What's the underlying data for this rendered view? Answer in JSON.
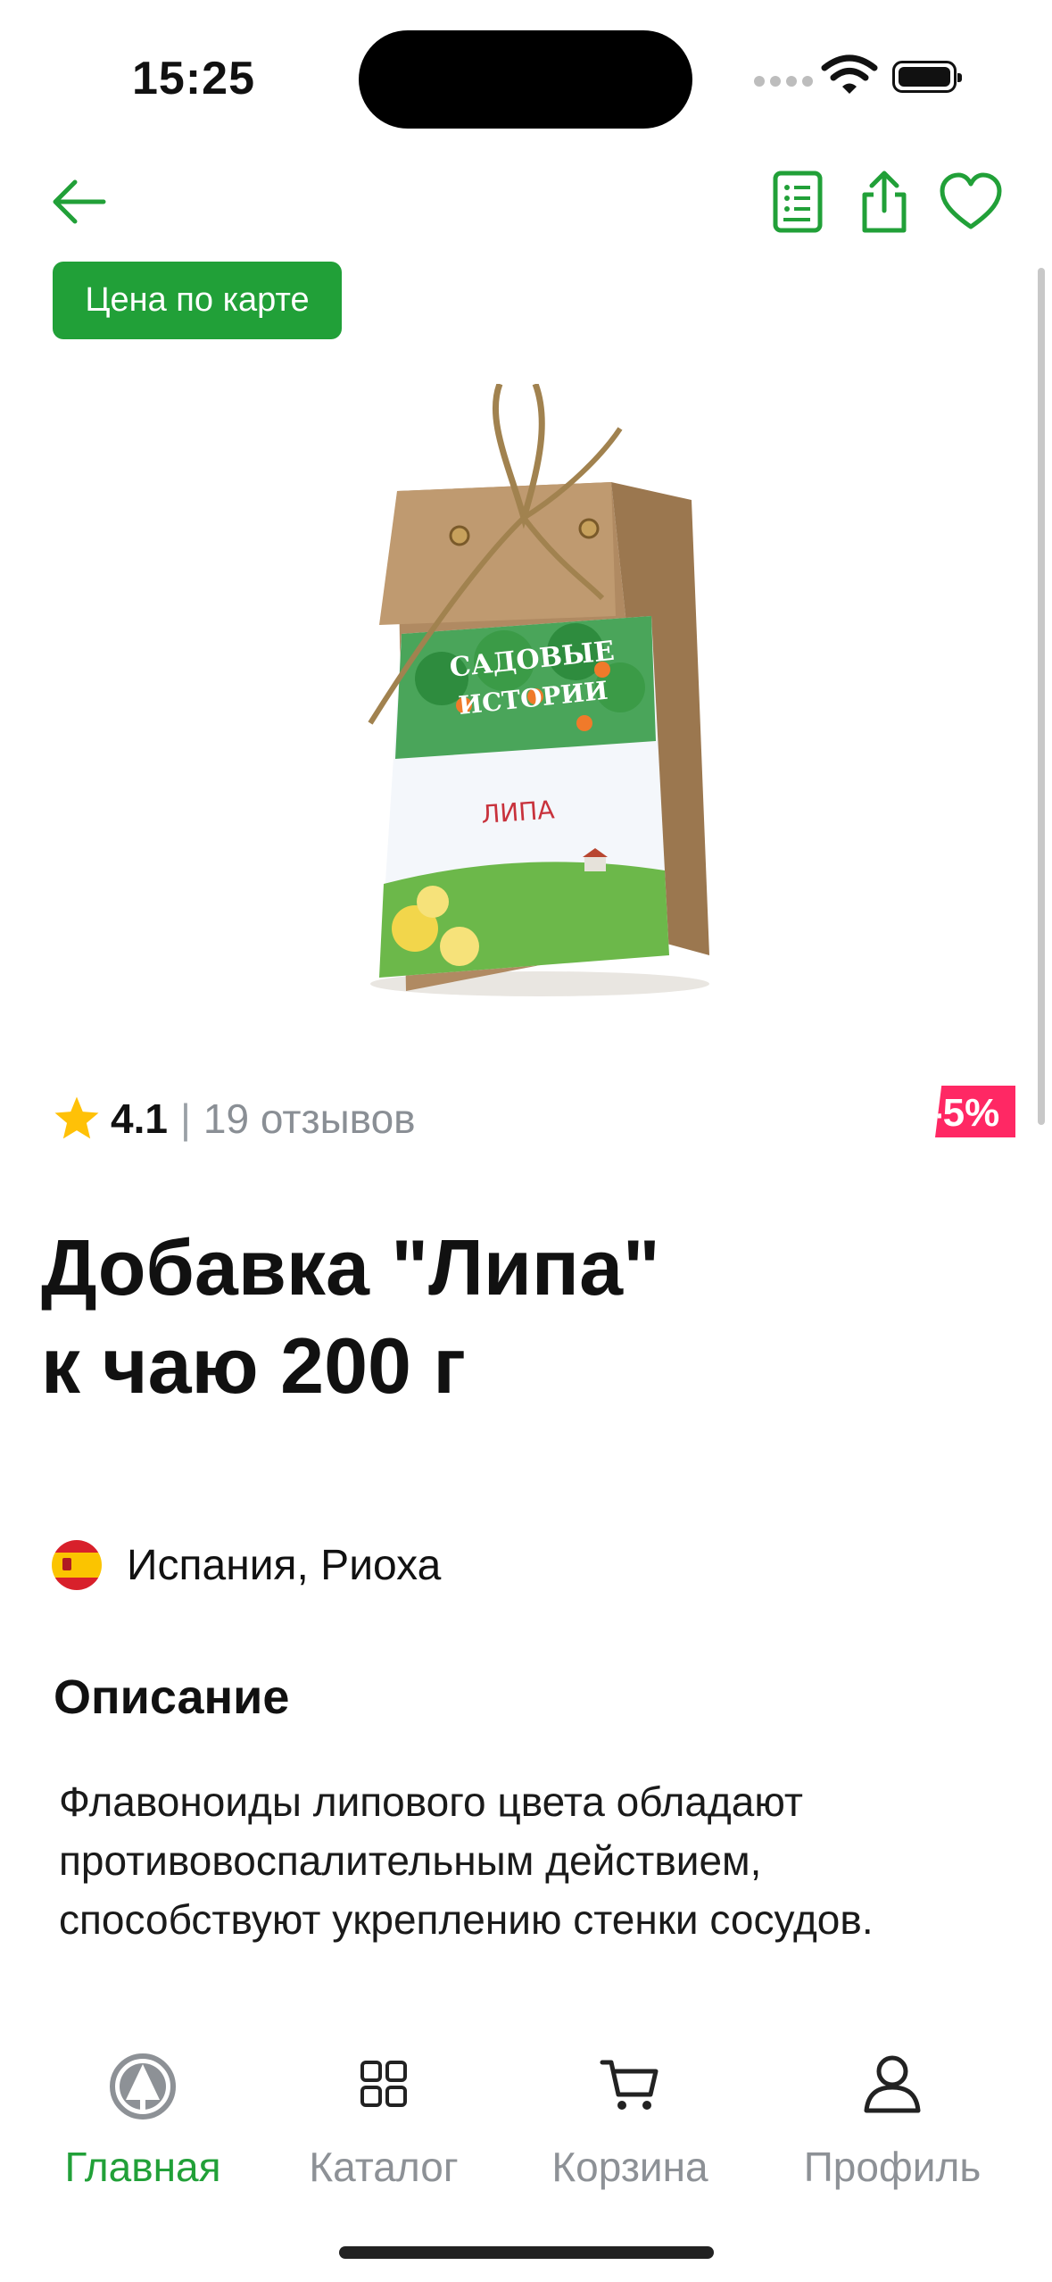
{
  "status_bar": {
    "time": "15:25"
  },
  "header": {
    "back_icon": "arrow-left-icon",
    "actions": [
      "list-icon",
      "share-icon",
      "heart-icon"
    ]
  },
  "badge": {
    "label": "Цена по карте"
  },
  "product": {
    "image": "tea-bag-lipa",
    "rating": "4.1",
    "separator": "|",
    "reviews": "19 отзывов",
    "discount": "-5%",
    "title_line1": "Добавка \"Липа\"",
    "title_line2": "к чаю 200 г",
    "origin": "Испания, Риоха",
    "description_heading": "Описание",
    "description": "Флавоноиды липового цвета обладают противовоспалительным действием, способствуют укреплению стенки сосудов."
  },
  "tabbar": {
    "items": [
      {
        "label": "Главная",
        "icon": "home-tree-icon",
        "active": true
      },
      {
        "label": "Каталог",
        "icon": "grid-icon",
        "active": false
      },
      {
        "label": "Корзина",
        "icon": "cart-icon",
        "active": false
      },
      {
        "label": "Профиль",
        "icon": "person-icon",
        "active": false
      }
    ]
  },
  "colors": {
    "accent": "#21a038",
    "discount": "#ff2864",
    "muted": "#8d9196"
  }
}
